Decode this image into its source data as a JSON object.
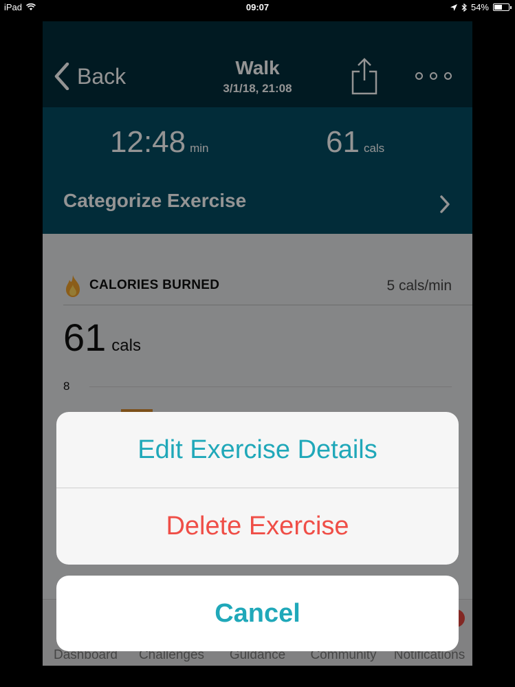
{
  "status_bar": {
    "device": "iPad",
    "time": "09:07",
    "battery": "54%",
    "battery_level": 0.54
  },
  "nav": {
    "back_label": "Back",
    "title": "Walk",
    "subtitle": "3/1/18, 21:08"
  },
  "stats": {
    "duration_value": "12:48",
    "duration_unit": "min",
    "cals_value": "61",
    "cals_unit": "cals"
  },
  "categorize": {
    "label": "Categorize Exercise"
  },
  "calories_card": {
    "title": "CALORIES BURNED",
    "rate": "5 cals/min",
    "total_value": "61",
    "total_unit": "cals",
    "axis_max_label": "8"
  },
  "tabs": [
    "Dashboard",
    "Challenges",
    "Guidance",
    "Community",
    "Notifications"
  ],
  "action_sheet": {
    "edit_label": "Edit Exercise Details",
    "delete_label": "Delete Exercise",
    "cancel_label": "Cancel"
  },
  "colors": {
    "nav_bg": "#032d3c",
    "stats_bg": "#054d63",
    "accent_teal": "#20a8b9",
    "destructive_red": "#ef4e47"
  }
}
